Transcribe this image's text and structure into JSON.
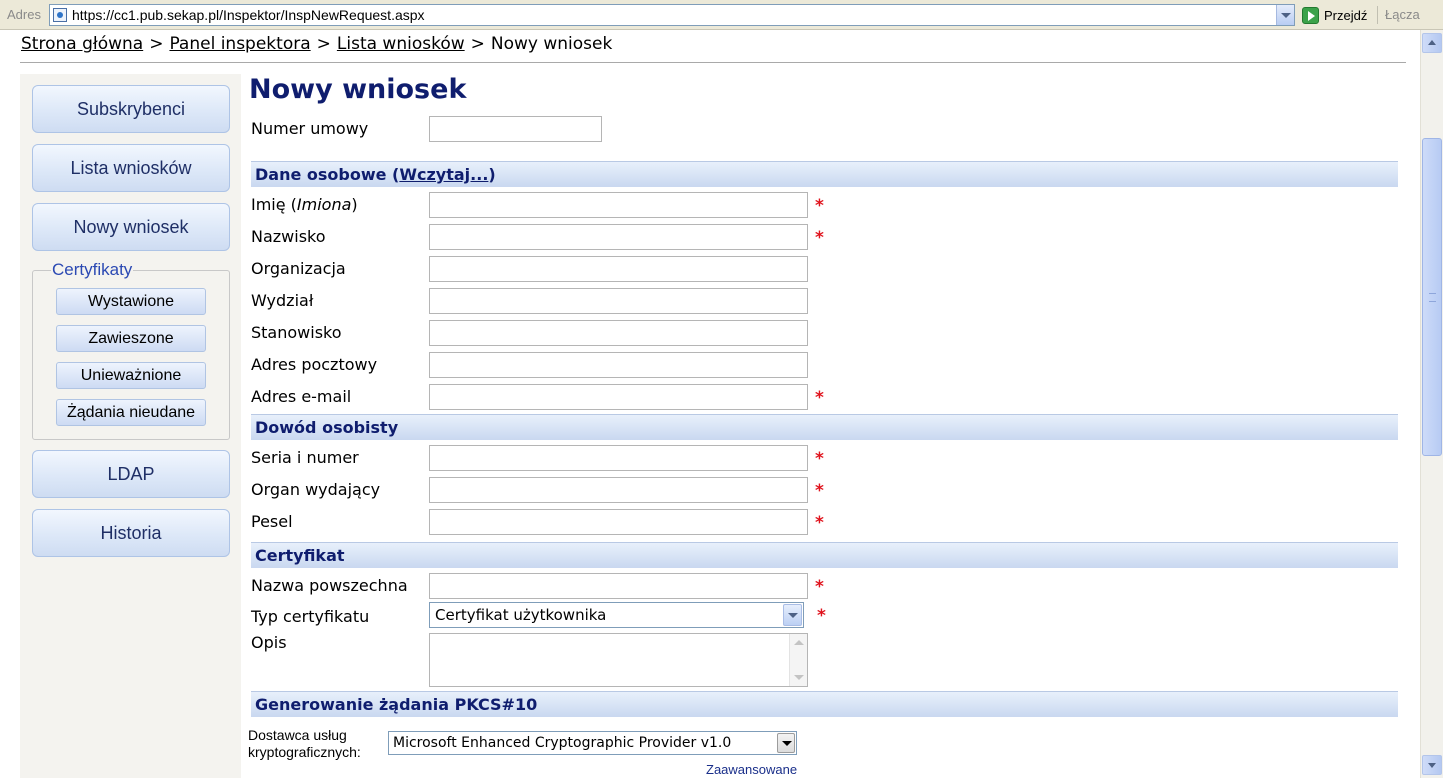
{
  "address_bar": {
    "label": "Adres",
    "url": "https://cc1.pub.sekap.pl/Inspektor/InspNewRequest.aspx",
    "go_label": "Przejdź",
    "links_label": "Łącza"
  },
  "breadcrumb": {
    "items": [
      "Strona główna",
      "Panel inspektora",
      "Lista wniosków"
    ],
    "current": "Nowy wniosek",
    "separator": ">"
  },
  "sidebar": {
    "buttons": {
      "subskrybenci": "Subskrybenci",
      "lista": "Lista wniosków",
      "nowy": "Nowy wniosek",
      "ldap": "LDAP",
      "historia": "Historia"
    },
    "certyfikaty": {
      "legend": "Certyfikaty",
      "items": [
        "Wystawione",
        "Zawieszone",
        "Unieważnione",
        "Żądania nieudane"
      ]
    }
  },
  "form": {
    "title": "Nowy wniosek",
    "numer_umowy": {
      "label": "Numer umowy",
      "value": ""
    },
    "sections": {
      "dane_osobowe": "Dane osobowe (",
      "wczytaj": "Wczytaj...",
      "dane_osobowe_close": ")",
      "dowod": "Dowód osobisty",
      "certyfikat": "Certyfikat",
      "pkcs": "Generowanie żądania PKCS#10"
    },
    "imie": {
      "label": "Imię (",
      "label_italic": "Imiona",
      "label_close": ")",
      "value": ""
    },
    "nazwisko": {
      "label": "Nazwisko",
      "value": ""
    },
    "organizacja": {
      "label": "Organizacja",
      "value": ""
    },
    "wydzial": {
      "label": "Wydział",
      "value": ""
    },
    "stanowisko": {
      "label": "Stanowisko",
      "value": ""
    },
    "adres_pocztowy": {
      "label": "Adres pocztowy",
      "value": ""
    },
    "email": {
      "label": "Adres e-mail",
      "value": ""
    },
    "seria": {
      "label": "Seria i numer",
      "value": ""
    },
    "organ": {
      "label": "Organ wydający",
      "value": ""
    },
    "pesel": {
      "label": "Pesel",
      "value": ""
    },
    "nazwa": {
      "label": "Nazwa powszechna",
      "value": ""
    },
    "typ": {
      "label": "Typ certyfikatu",
      "selected": "Certyfikat użytkownika"
    },
    "opis": {
      "label": "Opis",
      "value": ""
    },
    "dostawca": {
      "label_line1": "Dostawca usług",
      "label_line2": "kryptograficznych:",
      "selected": "Microsoft Enhanced Cryptographic Provider v1.0"
    },
    "advanced": "Zaawansowane",
    "required_mark": "*"
  },
  "colors": {
    "title": "#0f1d6e",
    "required": "#e0141e",
    "section_bg": "#c9d8f0",
    "sidebar_bg": "#f4f3ef"
  }
}
